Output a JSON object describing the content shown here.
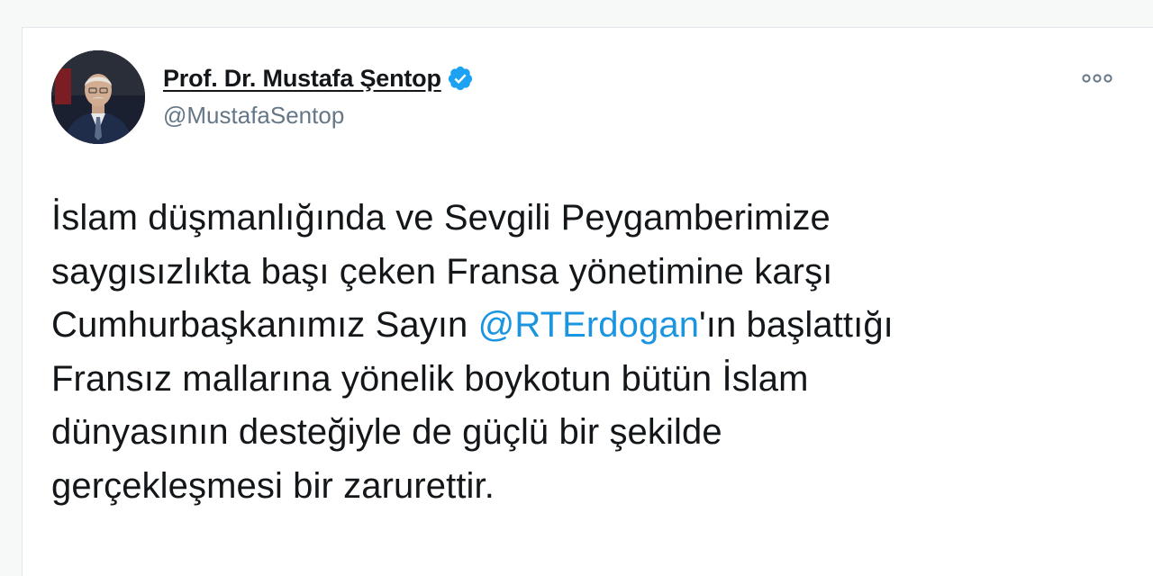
{
  "author": {
    "name": "Prof. Dr. Mustafa Şentop",
    "handle": "@MustafaSentop",
    "verified": true,
    "verified_icon": "verified-badge-icon",
    "verified_color": "#1da1f2"
  },
  "menu": {
    "icon": "more-dots-icon"
  },
  "tweet": {
    "line1": "İslam düşmanlığında ve Sevgili Peygamberimize",
    "line2": "saygısızlıkta başı çeken Fransa yönetimine karşı",
    "line3_before": "Cumhurbaşkanımız Sayın ",
    "line3_mention": "@RTErdogan",
    "line3_after": "'ın başlattığı",
    "line4": "Fransız mallarına yönelik boykotun bütün İslam",
    "line5": "dünyasının desteğiyle de güçlü bir şekilde",
    "line6": "gerçekleşmesi bir zarurettir."
  },
  "colors": {
    "text": "#14171a",
    "secondary": "#657786",
    "link": "#1b95e0",
    "background": "#ffffff"
  }
}
